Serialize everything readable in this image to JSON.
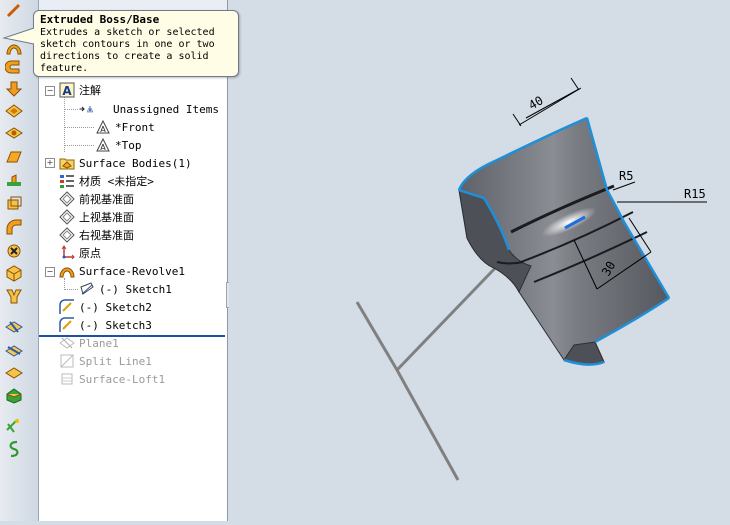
{
  "tooltip": {
    "title": "Extruded Boss/Base",
    "body_lines": [
      "Extrudes a sketch or selected",
      "sketch contours in one or two",
      "directions to create a solid",
      "feature."
    ]
  },
  "tree": {
    "annotations": "注解",
    "unassigned": "Unassigned Items",
    "front_annot": "*Front",
    "top_annot": "*Top",
    "surface_bodies": "Surface Bodies(1)",
    "material": "材质 <未指定>",
    "front_plane": "前视基准面",
    "top_plane": "上视基准面",
    "right_plane": "右视基准面",
    "origin": "原点",
    "revolve": "Surface-Revolve1",
    "revolve_sketch": "(-) Sketch1",
    "sketch2": "(-) Sketch2",
    "sketch3": "(-) Sketch3",
    "plane1": "Plane1",
    "split_line": "Split Line1",
    "loft": "Surface-Loft1"
  },
  "dimensions": {
    "d40": "40",
    "r5": "R5",
    "r15": "R15",
    "d30": "30"
  },
  "splitter": "‹",
  "colors": {
    "part_dark": "#6e7178",
    "edge_highlight": "#1e8fd8",
    "rollback_bar": "#1f50a8"
  }
}
